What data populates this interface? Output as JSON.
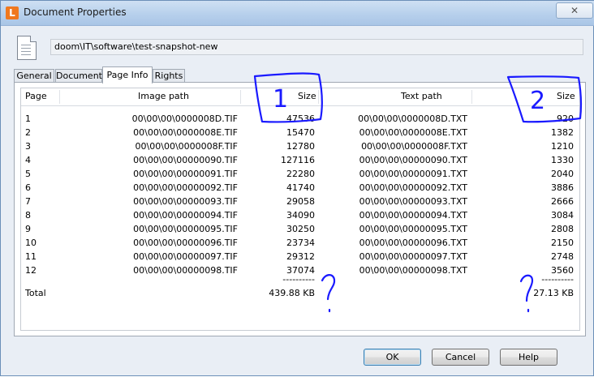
{
  "window": {
    "title": "Document Properties",
    "app_icon_letter": "L",
    "close_glyph": "✕"
  },
  "document": {
    "path": "doom\\IT\\software\\test-snapshot-new"
  },
  "tabs": [
    {
      "label": "General",
      "active": false
    },
    {
      "label": "Document",
      "active": false
    },
    {
      "label": "Page Info",
      "active": true
    },
    {
      "label": "Rights",
      "active": false
    }
  ],
  "table": {
    "columns": {
      "page": "Page",
      "image_path": "Image path",
      "image_size": "Size",
      "text_path": "Text path",
      "text_size": "Size"
    },
    "rows": [
      {
        "page": "1",
        "image_path": "00\\00\\00\\0000008D.TIF",
        "image_size": "47536",
        "text_path": "00\\00\\00\\0000008D.TXT",
        "text_size": "920"
      },
      {
        "page": "2",
        "image_path": "00\\00\\00\\0000008E.TIF",
        "image_size": "15470",
        "text_path": "00\\00\\00\\0000008E.TXT",
        "text_size": "1382"
      },
      {
        "page": "3",
        "image_path": "00\\00\\00\\0000008F.TIF",
        "image_size": "12780",
        "text_path": "00\\00\\00\\0000008F.TXT",
        "text_size": "1210"
      },
      {
        "page": "4",
        "image_path": "00\\00\\00\\00000090.TIF",
        "image_size": "127116",
        "text_path": "00\\00\\00\\00000090.TXT",
        "text_size": "1330"
      },
      {
        "page": "5",
        "image_path": "00\\00\\00\\00000091.TIF",
        "image_size": "22280",
        "text_path": "00\\00\\00\\00000091.TXT",
        "text_size": "2040"
      },
      {
        "page": "6",
        "image_path": "00\\00\\00\\00000092.TIF",
        "image_size": "41740",
        "text_path": "00\\00\\00\\00000092.TXT",
        "text_size": "3886"
      },
      {
        "page": "7",
        "image_path": "00\\00\\00\\00000093.TIF",
        "image_size": "29058",
        "text_path": "00\\00\\00\\00000093.TXT",
        "text_size": "2666"
      },
      {
        "page": "8",
        "image_path": "00\\00\\00\\00000094.TIF",
        "image_size": "34090",
        "text_path": "00\\00\\00\\00000094.TXT",
        "text_size": "3084"
      },
      {
        "page": "9",
        "image_path": "00\\00\\00\\00000095.TIF",
        "image_size": "30250",
        "text_path": "00\\00\\00\\00000095.TXT",
        "text_size": "2808"
      },
      {
        "page": "10",
        "image_path": "00\\00\\00\\00000096.TIF",
        "image_size": "23734",
        "text_path": "00\\00\\00\\00000096.TXT",
        "text_size": "2150"
      },
      {
        "page": "11",
        "image_path": "00\\00\\00\\00000097.TIF",
        "image_size": "29312",
        "text_path": "00\\00\\00\\00000097.TXT",
        "text_size": "2748"
      },
      {
        "page": "12",
        "image_path": "00\\00\\00\\00000098.TIF",
        "image_size": "37074",
        "text_path": "00\\00\\00\\00000098.TXT",
        "text_size": "3560"
      }
    ],
    "separator": "----------",
    "total": {
      "label": "Total",
      "image_size": "439.88 KB",
      "text_size": "27.13 KB"
    }
  },
  "annotations": {
    "mark_1": "1",
    "mark_2": "2",
    "question_1": "?",
    "question_2": "?",
    "ink_color": "#1a1aff"
  },
  "buttons": {
    "ok": "OK",
    "cancel": "Cancel",
    "help": "Help"
  }
}
